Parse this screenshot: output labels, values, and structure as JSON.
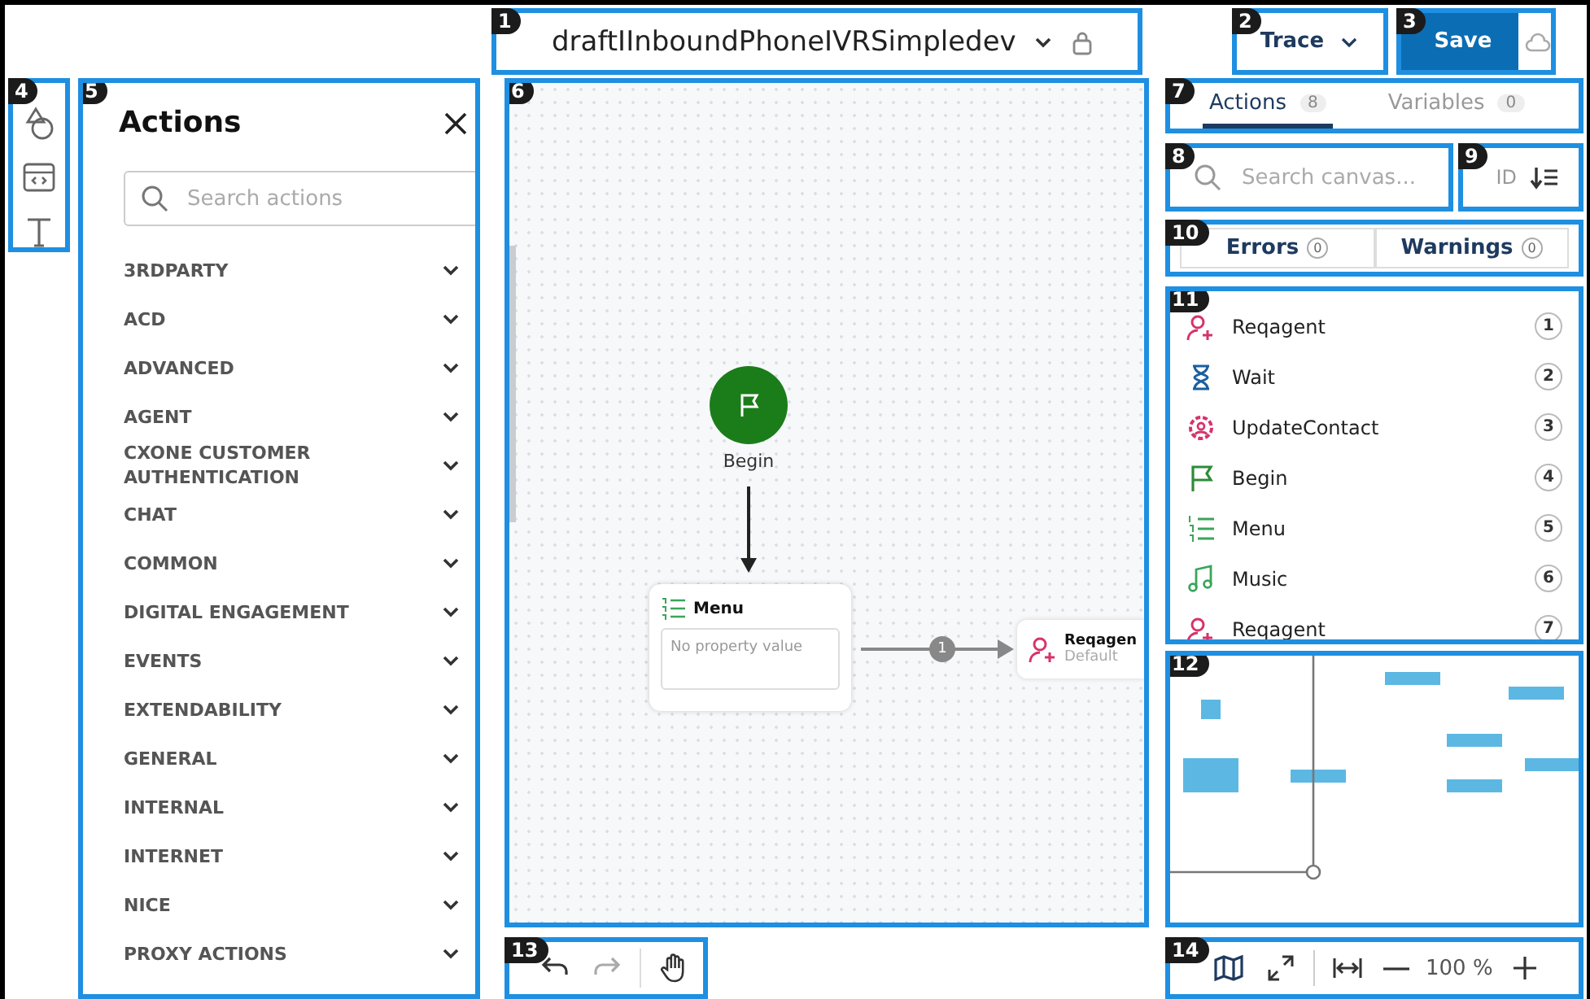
{
  "header": {
    "callout": "1",
    "title": "draftIInboundPhoneIVRSimpledev"
  },
  "trace": {
    "callout": "2",
    "label": "Trace"
  },
  "save": {
    "callout": "3",
    "label": "Save"
  },
  "tool_rail": {
    "callout": "4"
  },
  "actions_panel": {
    "callout": "5",
    "title": "Actions",
    "search": {
      "placeholder": "Search actions"
    },
    "categories": [
      {
        "label": "3RDPARTY",
        "expanded": false
      },
      {
        "label": "ACD",
        "expanded": false
      },
      {
        "label": "ADVANCED",
        "expanded": false
      },
      {
        "label": "AGENT",
        "expanded": false
      },
      {
        "label": "CXONE CUSTOMER AUTHENTICATION",
        "expanded": false
      },
      {
        "label": "CHAT",
        "expanded": false
      },
      {
        "label": "COMMON",
        "expanded": false
      },
      {
        "label": "DIGITAL ENGAGEMENT",
        "expanded": false
      },
      {
        "label": "EVENTS",
        "expanded": false
      },
      {
        "label": "EXTENDABILITY",
        "expanded": false
      },
      {
        "label": "GENERAL",
        "expanded": false
      },
      {
        "label": "INTERNAL",
        "expanded": false
      },
      {
        "label": "INTERNET",
        "expanded": false
      },
      {
        "label": "NICE",
        "expanded": false
      },
      {
        "label": "PROXY ACTIONS",
        "expanded": false
      }
    ]
  },
  "canvas": {
    "callout": "6",
    "begin_node": {
      "label": "Begin"
    },
    "menu_node": {
      "title": "Menu",
      "body": "No property value"
    },
    "link_label": "1",
    "reqagent_node": {
      "title": "Reqagen",
      "subtitle": "Default"
    }
  },
  "right_tabs": {
    "callout": "7",
    "tabs": [
      {
        "label": "Actions",
        "count": "8",
        "selected": true
      },
      {
        "label": "Variables",
        "count": "0",
        "selected": false
      }
    ]
  },
  "canvas_search": {
    "callout": "8",
    "placeholder": "Search canvas..."
  },
  "sort": {
    "callout": "9",
    "label": "ID"
  },
  "issues": {
    "callout": "10",
    "buttons": [
      {
        "label": "Errors",
        "count": "0"
      },
      {
        "label": "Warnings",
        "count": "0"
      }
    ]
  },
  "outline": {
    "callout": "11",
    "items": [
      {
        "kind": "reqagent",
        "name": "Reqagent",
        "number": "1"
      },
      {
        "kind": "wait",
        "name": "Wait",
        "number": "2"
      },
      {
        "kind": "updatecontact",
        "name": "UpdateContact",
        "number": "3"
      },
      {
        "kind": "begin",
        "name": "Begin",
        "number": "4"
      },
      {
        "kind": "menu",
        "name": "Menu",
        "number": "5"
      },
      {
        "kind": "music",
        "name": "Music",
        "number": "6"
      },
      {
        "kind": "reqagent",
        "name": "Reqagent",
        "number": "7"
      }
    ]
  },
  "minimap": {
    "callout": "12"
  },
  "history": {
    "callout": "13",
    "buttons": [
      {
        "kind": "undo",
        "disabled": false
      },
      {
        "kind": "redo",
        "disabled": true
      },
      {
        "kind": "pan",
        "disabled": false
      }
    ]
  },
  "zoom_bar": {
    "callout": "14",
    "zoom": "100 %"
  }
}
